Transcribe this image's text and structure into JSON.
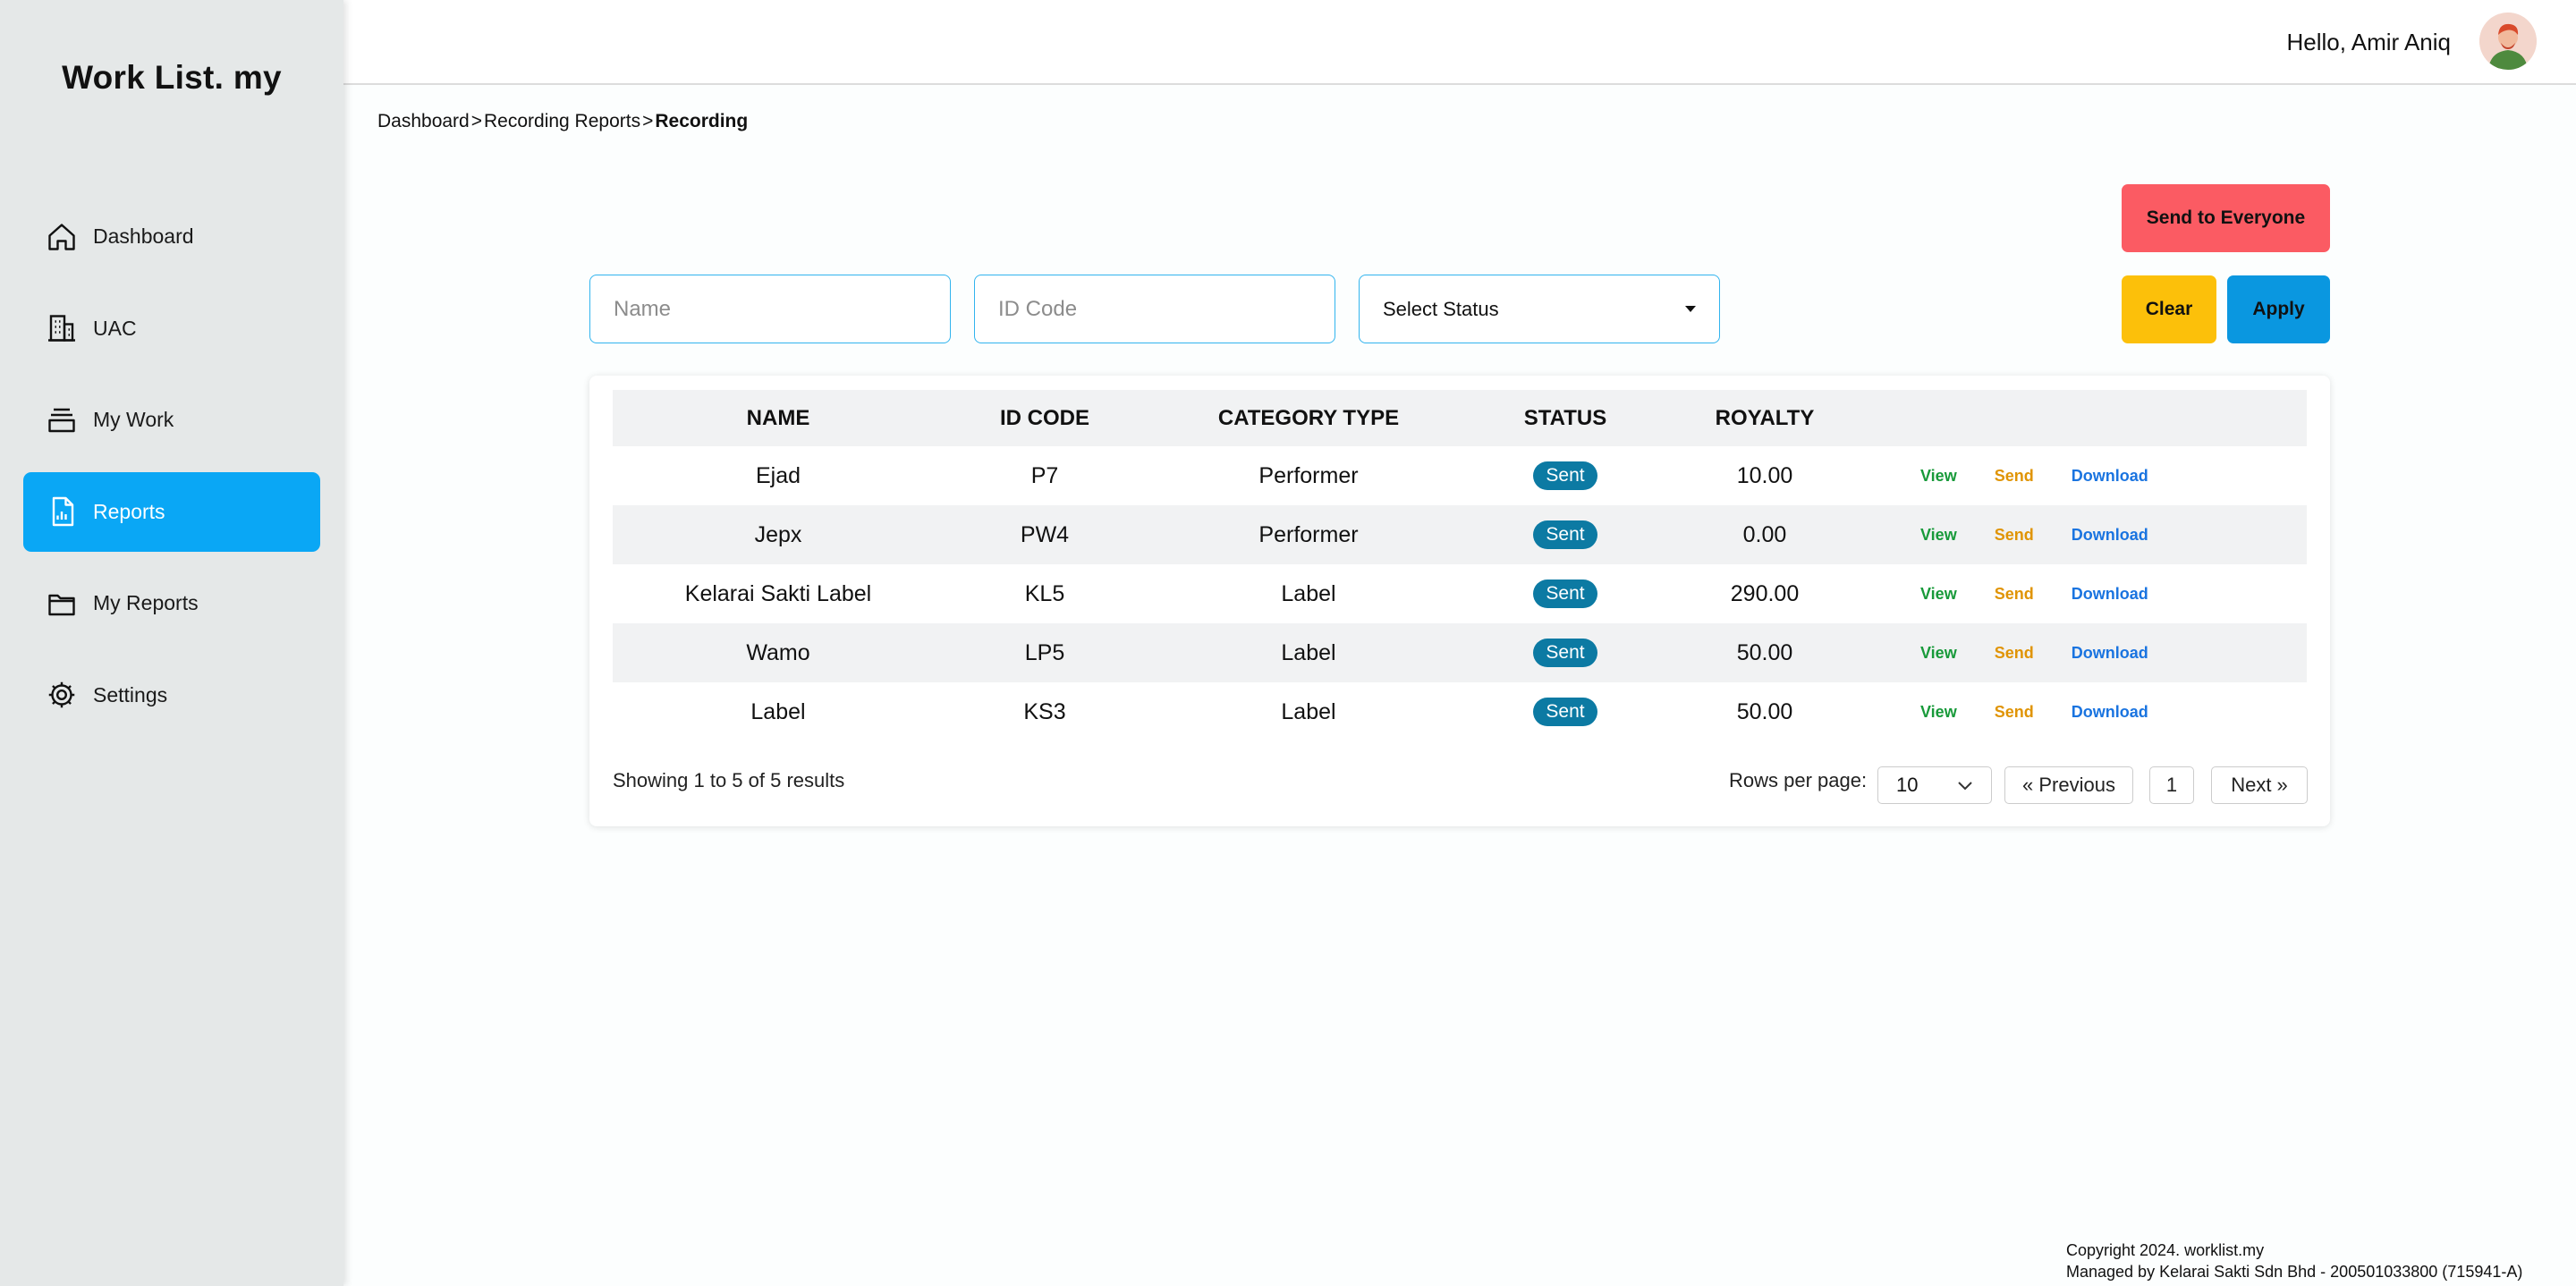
{
  "app": {
    "title": "Work List. my"
  },
  "sidebar": {
    "items": [
      {
        "label": "Dashboard",
        "icon": "home-icon"
      },
      {
        "label": "UAC",
        "icon": "building-icon"
      },
      {
        "label": "My Work",
        "icon": "archive-icon"
      },
      {
        "label": "Reports",
        "icon": "report-icon",
        "active": true
      },
      {
        "label": "My Reports",
        "icon": "folder-icon"
      },
      {
        "label": "Settings",
        "icon": "gear-icon"
      }
    ],
    "active_color": "#0aa7f5"
  },
  "header": {
    "greeting": "Hello, Amir Aniq"
  },
  "breadcrumb": {
    "items": [
      "Dashboard",
      "Recording Reports",
      "Recording"
    ],
    "separator": ">"
  },
  "actions": {
    "send_all": "Send to Everyone",
    "clear": "Clear",
    "apply": "Apply"
  },
  "filters": {
    "name_placeholder": "Name",
    "id_placeholder": "ID Code",
    "status_label": "Select Status"
  },
  "table": {
    "columns": [
      "NAME",
      "ID CODE",
      "CATEGORY TYPE",
      "STATUS",
      "ROYALTY"
    ],
    "rows": [
      {
        "name": "Ejad",
        "id": "P7",
        "category": "Performer",
        "status": "Sent",
        "royalty": "10.00"
      },
      {
        "name": "Jepx",
        "id": "PW4",
        "category": "Performer",
        "status": "Sent",
        "royalty": "0.00"
      },
      {
        "name": "Kelarai Sakti Label",
        "id": "KL5",
        "category": "Label",
        "status": "Sent",
        "royalty": "290.00"
      },
      {
        "name": "Wamo",
        "id": "LP5",
        "category": "Label",
        "status": "Sent",
        "royalty": "50.00"
      },
      {
        "name": "Label",
        "id": "KS3",
        "category": "Label",
        "status": "Sent",
        "royalty": "50.00"
      }
    ],
    "row_actions": {
      "view": "View",
      "send": "Send",
      "download": "Download"
    }
  },
  "pagination": {
    "showing": "Showing 1 to 5 of 5 results",
    "rows_per_page_label": "Rows per page:",
    "rows_per_page": "10",
    "previous": "« Previous",
    "page": "1",
    "next": "Next »"
  },
  "footer": {
    "copyright": "Copyright 2024. worklist.my",
    "managed_by": "Managed by Kelarai Sakti Sdn Bhd - 200501033800 (715941-A)"
  }
}
